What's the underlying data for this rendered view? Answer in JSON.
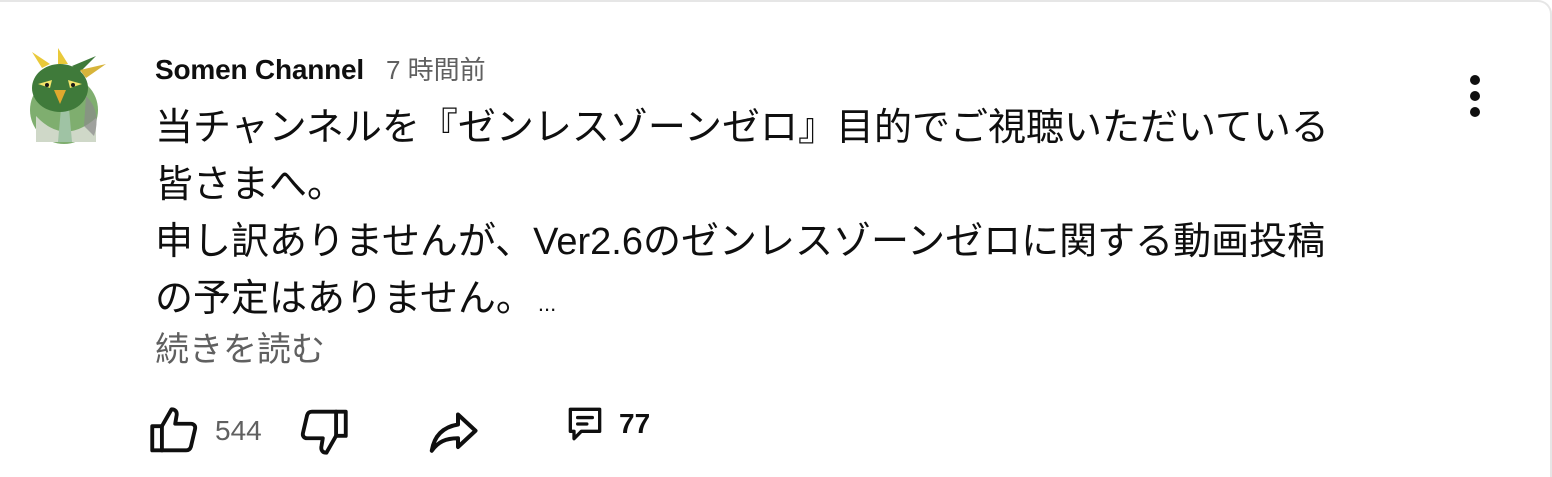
{
  "comment": {
    "author": "Somen Channel",
    "time": "7 時間前",
    "lines": [
      "当チャンネルを『ゼンレスゾーンゼロ』目的でご視聴いただいている",
      "皆さまへ。",
      "申し訳ありませんが、Ver2.6のゼンレスゾーンゼロに関する動画投稿",
      "の予定はありません。"
    ],
    "ellipsis": "...",
    "read_more": "続きを読む",
    "likes": "544",
    "replies": "77"
  },
  "icons": {
    "avatar": "parrot-avatar-icon",
    "menu": "more-vert-icon",
    "like": "thumbs-up-icon",
    "dislike": "thumbs-down-icon",
    "share": "share-arrow-icon",
    "reply": "comment-bubble-icon"
  },
  "colors": {
    "text": "#0f0f0f",
    "secondary": "#606060",
    "avatar_green": "#3f7a3a",
    "avatar_yellow": "#e9c93a"
  }
}
